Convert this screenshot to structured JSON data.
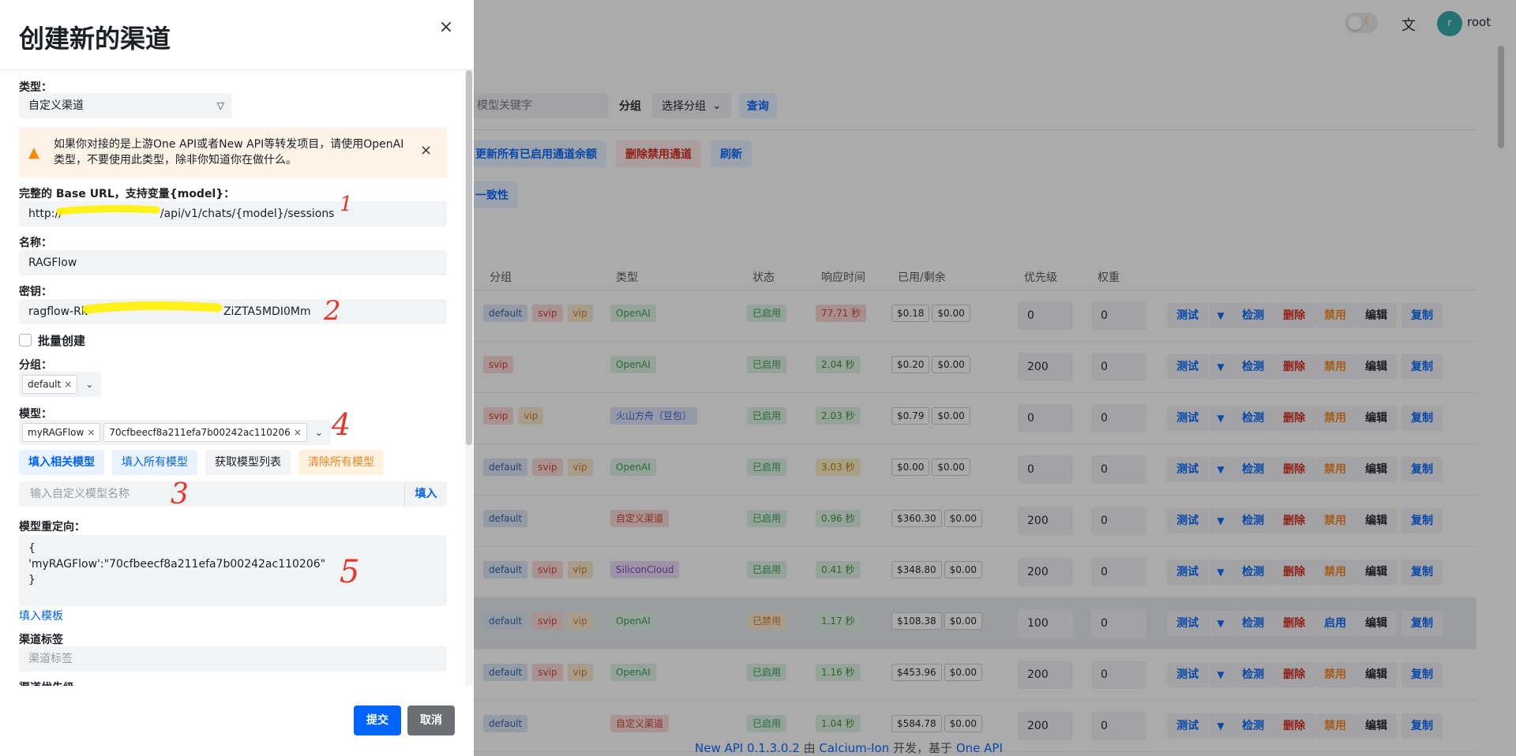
{
  "header": {
    "username": "root",
    "avatar_letter": "r",
    "theme_icon": "moon-icon",
    "lang_icon": "translate-icon"
  },
  "filters": {
    "keyword_placeholder": "模型关键字",
    "group_label": "分组",
    "group_select": "选择分组",
    "query": "查询"
  },
  "actions": {
    "update_balance": "更新所有已启用通道余额",
    "delete_disabled": "删除禁用通道",
    "refresh": "刷新",
    "consistency": "一致性"
  },
  "table": {
    "headers": [
      "分组",
      "类型",
      "状态",
      "响应时间",
      "已用/剩余",
      "优先级",
      "权重"
    ],
    "ops": {
      "test": "测试",
      "detect": "检测",
      "delete": "删除",
      "disable": "禁用",
      "enable": "启用",
      "edit": "编辑",
      "copy": "复制"
    },
    "rows": [
      {
        "groups": [
          "default",
          "svip",
          "vip"
        ],
        "type": "OpenAI",
        "type_style": "green",
        "status": "已启用",
        "rt": "77.71 秒",
        "rt_style": "red",
        "used": "$0.18",
        "remain": "$0.00",
        "priority": "0",
        "weight": "0",
        "toggle": "禁用"
      },
      {
        "groups": [
          "svip"
        ],
        "type": "OpenAI",
        "type_style": "green",
        "status": "已启用",
        "rt": "2.04 秒",
        "rt_style": "green",
        "used": "$0.20",
        "remain": "$0.00",
        "priority": "200",
        "weight": "0",
        "toggle": "禁用"
      },
      {
        "groups": [
          "svip",
          "vip"
        ],
        "type": "火山方舟（豆包）",
        "type_style": "blue",
        "status": "已启用",
        "rt": "2.03 秒",
        "rt_style": "green",
        "used": "$0.79",
        "remain": "$0.00",
        "priority": "0",
        "weight": "0",
        "toggle": "禁用"
      },
      {
        "groups": [
          "default",
          "svip",
          "vip"
        ],
        "type": "OpenAI",
        "type_style": "green",
        "status": "已启用",
        "rt": "3.03 秒",
        "rt_style": "yellow",
        "used": "$0.00",
        "remain": "$0.00",
        "priority": "0",
        "weight": "0",
        "toggle": "禁用"
      },
      {
        "groups": [
          "default"
        ],
        "type": "自定义渠道",
        "type_style": "red",
        "status": "已启用",
        "rt": "0.96 秒",
        "rt_style": "green",
        "used": "$360.30",
        "remain": "$0.00",
        "priority": "200",
        "weight": "0",
        "toggle": "禁用"
      },
      {
        "groups": [
          "default",
          "svip",
          "vip"
        ],
        "type": "SiliconCloud",
        "type_style": "purple",
        "status": "已启用",
        "rt": "0.41 秒",
        "rt_style": "green",
        "used": "$348.80",
        "remain": "$0.00",
        "priority": "200",
        "weight": "0",
        "toggle": "禁用"
      },
      {
        "groups": [
          "default",
          "svip",
          "vip"
        ],
        "type": "OpenAI",
        "type_style": "green",
        "status": "已禁用",
        "rt": "1.17 秒",
        "rt_style": "green",
        "used": "$108.38",
        "remain": "$0.00",
        "priority": "100",
        "weight": "0",
        "toggle": "启用",
        "disabled": true
      },
      {
        "groups": [
          "default",
          "svip",
          "vip"
        ],
        "type": "OpenAI",
        "type_style": "green",
        "status": "已启用",
        "rt": "1.16 秒",
        "rt_style": "green",
        "used": "$453.96",
        "remain": "$0.00",
        "priority": "200",
        "weight": "0",
        "toggle": "禁用"
      },
      {
        "groups": [
          "default"
        ],
        "type": "自定义渠道",
        "type_style": "red",
        "status": "已启用",
        "rt": "1.04 秒",
        "rt_style": "green",
        "used": "$584.78",
        "remain": "$0.00",
        "priority": "200",
        "weight": "0",
        "toggle": "禁用"
      }
    ]
  },
  "footer": {
    "product": "New API 0.1.3.0.2",
    "by": "由",
    "author": "Calcium-Ion",
    "dev": "开发，基于",
    "base": "One API"
  },
  "sheet": {
    "title": "创建新的渠道",
    "type_label": "类型：",
    "type_value": "自定义渠道",
    "warning": "如果你对接的是上游One API或者New API等转发项目，请使用OpenAI类型，不要使用此类型，除非你知道你在做什么。",
    "baseurl_label": "完整的 Base URL，支持变量{model}：",
    "baseurl_value_prefix": "http://",
    "baseurl_value_suffix": "/api/v1/chats/{model}/sessions",
    "name_label": "名称：",
    "name_value": "RAGFlow",
    "key_label": "密钥：",
    "key_value_prefix": "ragflow-Rk",
    "key_value_suffix": "ZiZTA5MDI0Mm",
    "batch_label": "批量创建",
    "group_label": "分组：",
    "group_chip": "default",
    "model_label": "模型：",
    "model_chips": [
      "myRAGFlow",
      "70cfbeecf8a211efa7b00242ac110206"
    ],
    "btn_fill_related": "填入相关模型",
    "btn_fill_all": "填入所有模型",
    "btn_fetch": "获取模型列表",
    "btn_clear": "清除所有模型",
    "custom_model_placeholder": "输入自定义模型名称",
    "custom_fill": "填入",
    "mapping_label": "模型重定向：",
    "mapping_lines": [
      "{",
      "'myRAGFlow':\"70cfbeecf8a211efa7b00242ac110206\"",
      "}"
    ],
    "template_link": "填入模板",
    "tag_label": "渠道标签",
    "tag_placeholder": "渠道标签",
    "priority_label_partial": "渠道优先级",
    "submit": "提交",
    "cancel": "取消"
  },
  "annotations": [
    "1",
    "2",
    "3",
    "4",
    "5"
  ]
}
